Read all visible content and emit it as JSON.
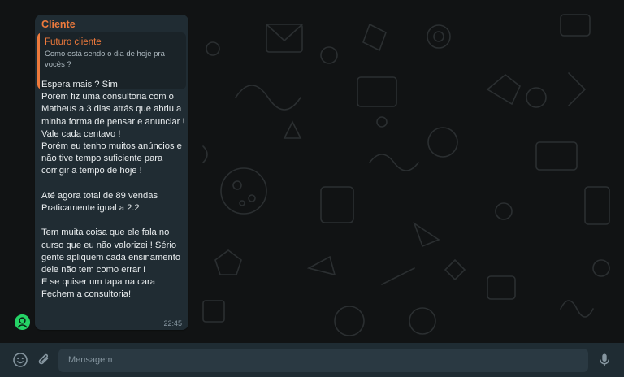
{
  "message": {
    "sender": "Cliente",
    "quote": {
      "author": "Futuro cliente",
      "text": "Como está sendo o dia de hoje pra vocês ?"
    },
    "body": "Espera mais ? Sim\nPorém fiz uma consultoria com o Matheus a 3 dias atrás que abriu a minha forma de pensar e anunciar !\nVale cada centavo !\nPorém eu tenho muitos anúncios e não tive tempo suficiente para corrigir a tempo de hoje !\n\nAté agora total de 89 vendas\nPraticamente igual a 2.2\n\nTem muita coisa que ele fala no curso que eu não valorizei ! Sério gente apliquem cada ensinamento dele não tem como errar !\nE se quiser um tapa na cara\nFechem a consultoria!",
    "time": "22:45"
  },
  "composer": {
    "placeholder": "Mensagem",
    "emoji_icon": "emoji-icon",
    "attach_icon": "paperclip-icon",
    "mic_icon": "microphone-icon"
  },
  "colors": {
    "sender": "#ee7a3c",
    "bubble": "#202c33",
    "footer": "#1f2c33",
    "input": "#2a3942"
  }
}
